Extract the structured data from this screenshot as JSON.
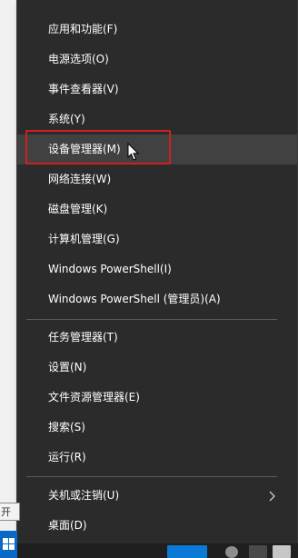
{
  "menu": {
    "items": [
      {
        "label": "应用和功能(F)"
      },
      {
        "label": "电源选项(O)"
      },
      {
        "label": "事件查看器(V)"
      },
      {
        "label": "系统(Y)"
      },
      {
        "label": "设备管理器(M)"
      },
      {
        "label": "网络连接(W)"
      },
      {
        "label": "磁盘管理(K)"
      },
      {
        "label": "计算机管理(G)"
      },
      {
        "label": "Windows PowerShell(I)"
      },
      {
        "label": "Windows PowerShell (管理员)(A)"
      },
      {
        "label": "任务管理器(T)"
      },
      {
        "label": "设置(N)"
      },
      {
        "label": "文件资源管理器(E)"
      },
      {
        "label": "搜索(S)"
      },
      {
        "label": "运行(R)"
      },
      {
        "label": "关机或注销(U)"
      },
      {
        "label": "桌面(D)"
      }
    ],
    "hovered_item": "设备管理器(M)",
    "submenu_arrow_icon": "chevron-right-icon"
  },
  "start_tooltip": {
    "text": "开始"
  },
  "colors": {
    "menu_background": "#2b2b2b",
    "menu_text": "#ffffff",
    "hover_background": "#414141",
    "highlight_border": "#d01f1f",
    "taskbar": "#1f1f1f",
    "start_button": "#0a68c6"
  }
}
